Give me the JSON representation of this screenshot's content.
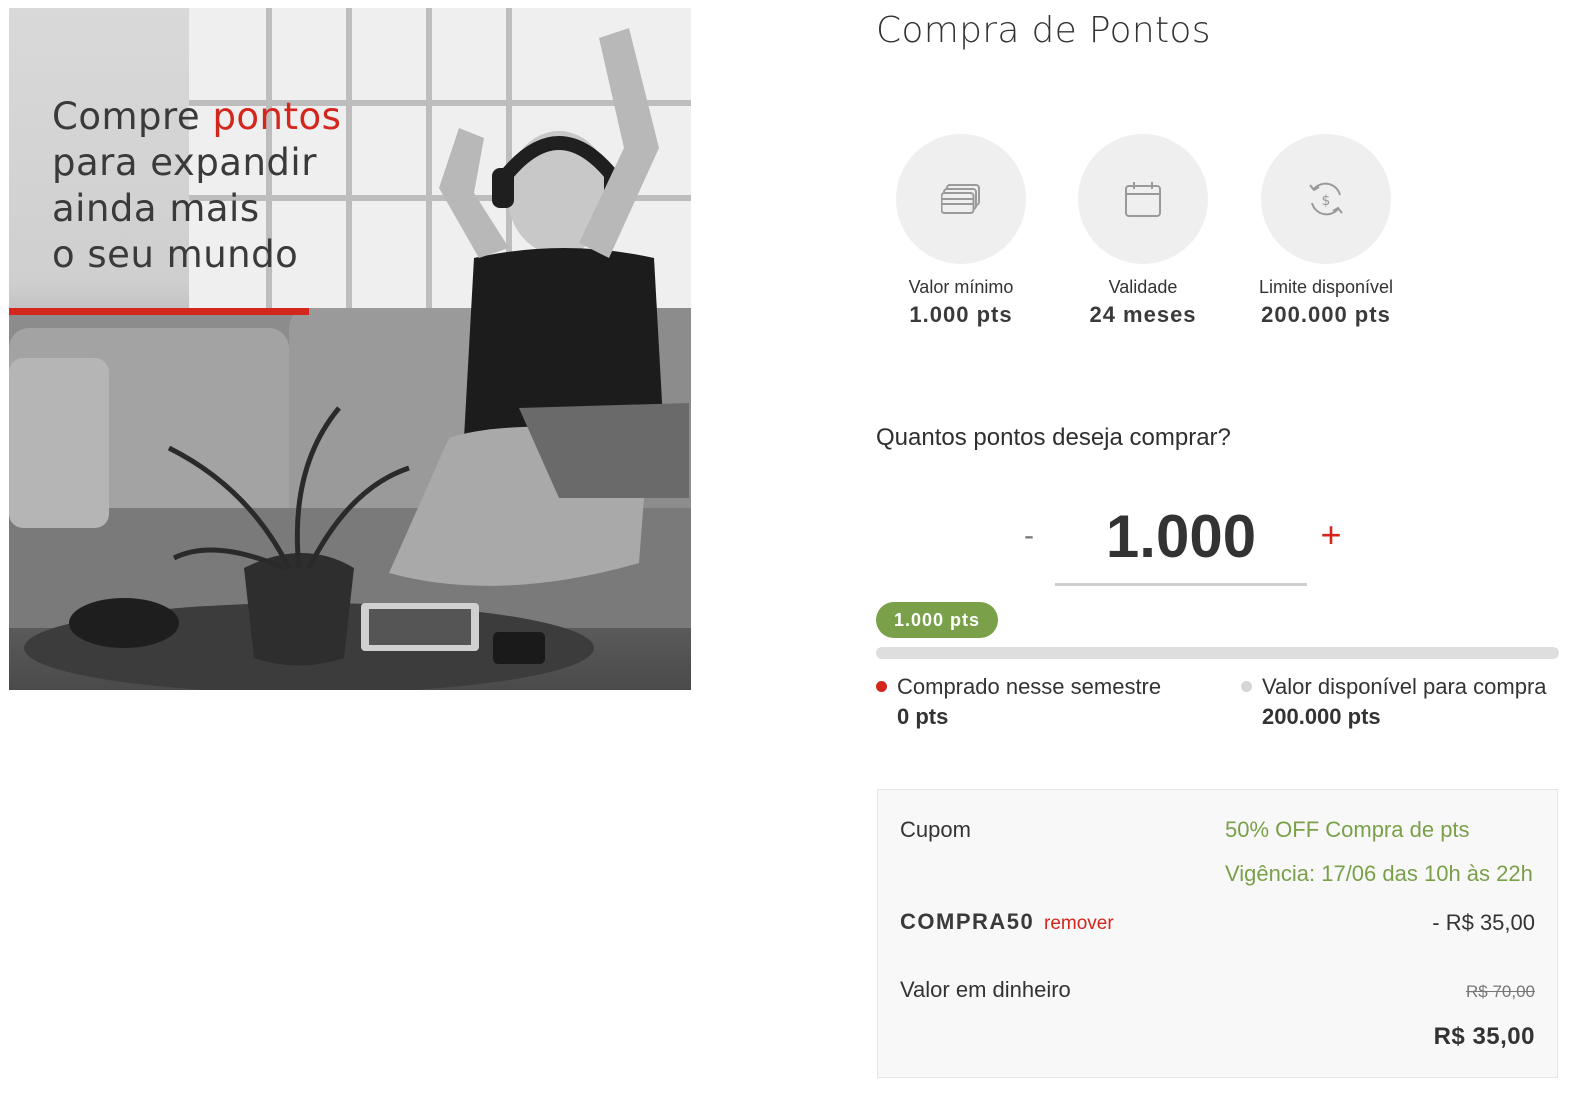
{
  "banner": {
    "headline_prefix": "Compre ",
    "headline_highlight": "pontos",
    "headline_lines": [
      "para expandir",
      "ainda mais",
      "o seu mundo"
    ],
    "accent_color": "#d3261c"
  },
  "page": {
    "title": "Compra de Pontos"
  },
  "info_cards": [
    {
      "icon": "cards-icon",
      "label": "Valor mínimo",
      "value": "1.000 pts"
    },
    {
      "icon": "calendar-icon",
      "label": "Validade",
      "value": "24 meses"
    },
    {
      "icon": "exchange-dollar-icon",
      "label": "Limite disponível",
      "value": "200.000 pts"
    }
  ],
  "purchase": {
    "question": "Quantos pontos deseja comprar?",
    "minus_label": "-",
    "plus_label": "+",
    "quantity": "1.000",
    "badge": "1.000 pts",
    "progress_fraction": 0
  },
  "legend": {
    "bought_label": "Comprado nesse semestre",
    "bought_value": "0 pts",
    "available_label": "Valor disponível para compra",
    "available_value": "200.000 pts"
  },
  "coupon": {
    "label": "Cupom",
    "offer": "50% OFF Compra de pts",
    "validity": "Vigência: 17/06 das 10h às 22h",
    "code": "COMPRA50",
    "remove_label": "remover",
    "discount": "- R$ 35,00",
    "cash_label": "Valor em dinheiro",
    "original_price": "R$ 70,00",
    "final_price": "R$ 35,00"
  },
  "colors": {
    "red": "#d3261c",
    "green": "#7aa04a",
    "grey_circle": "#efefef"
  }
}
